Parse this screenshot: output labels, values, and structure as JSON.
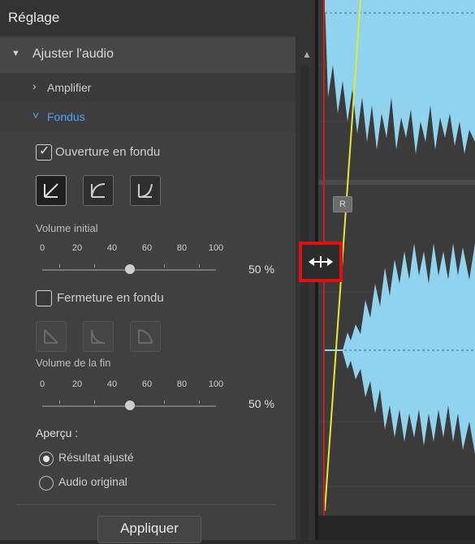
{
  "panel": {
    "title": "Réglage",
    "section_label": "Ajuster l'audio",
    "sub_amplifier": "Amplifier",
    "sub_fondus": "Fondus"
  },
  "fade_in": {
    "checkbox_label": "Ouverture en fondu",
    "checked": true,
    "volume_label": "Volume initial",
    "ticks": [
      "0",
      "20",
      "40",
      "60",
      "80",
      "100"
    ],
    "value": 50,
    "value_text": "50 %"
  },
  "fade_out": {
    "checkbox_label": "Fermeture en fondu",
    "checked": false,
    "volume_label": "Volume de la fin",
    "ticks": [
      "0",
      "20",
      "40",
      "60",
      "80",
      "100"
    ],
    "value": 50,
    "value_text": "50 %"
  },
  "preview": {
    "label": "Aperçu :",
    "options": [
      "Résultat ajusté",
      "Audio original"
    ],
    "selected": 0
  },
  "apply_label": "Appliquer",
  "track_marker": "R",
  "colors": {
    "waveform": "#8fd3ee",
    "fade_line": "#e8e832",
    "highlight": "#e01010",
    "active": "#4aa3ff"
  }
}
